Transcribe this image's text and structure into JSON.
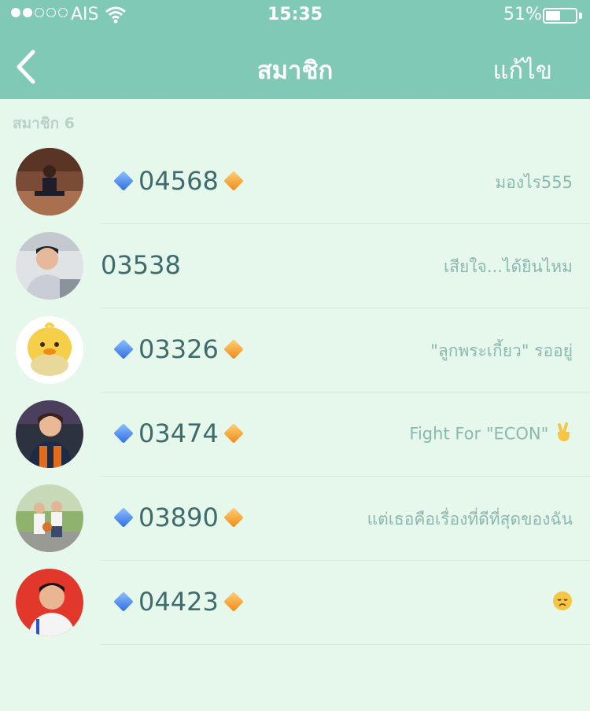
{
  "status_bar": {
    "signal_dots_filled": 2,
    "signal_dots_total": 5,
    "carrier": "AIS",
    "time": "15:35",
    "battery_percent": "51%",
    "battery_level": 0.51
  },
  "nav": {
    "back_icon": "chevron-left-icon",
    "title": "สมาชิก",
    "edit_label": "แก้ไข"
  },
  "section": {
    "label": "สมาชิก 6"
  },
  "members": [
    {
      "name": "04568",
      "status": "มองไร555",
      "gems": true
    },
    {
      "name": "03538",
      "status": "เสียใจ...ได้ยินไหม",
      "gems": false
    },
    {
      "name": "03326",
      "status": "\"ลูกพระเกี้ยว\" รออยู่",
      "gems": true
    },
    {
      "name": "03474",
      "status": "Fight For \"ECON\"",
      "status_emoji": "victory-hand-emoji",
      "gems": true
    },
    {
      "name": "03890",
      "status": "แต่เธอคือเรื่องที่ดีที่สุดของฉัน",
      "gems": true
    },
    {
      "name": "04423",
      "status": "",
      "status_emoji": "disappointed-face-emoji",
      "gems": true
    }
  ],
  "colors": {
    "header_bg": "#7fc9b6",
    "page_bg": "#e6f7ec",
    "name_text": "#3e6c6c",
    "status_text": "#8cb8b0"
  }
}
